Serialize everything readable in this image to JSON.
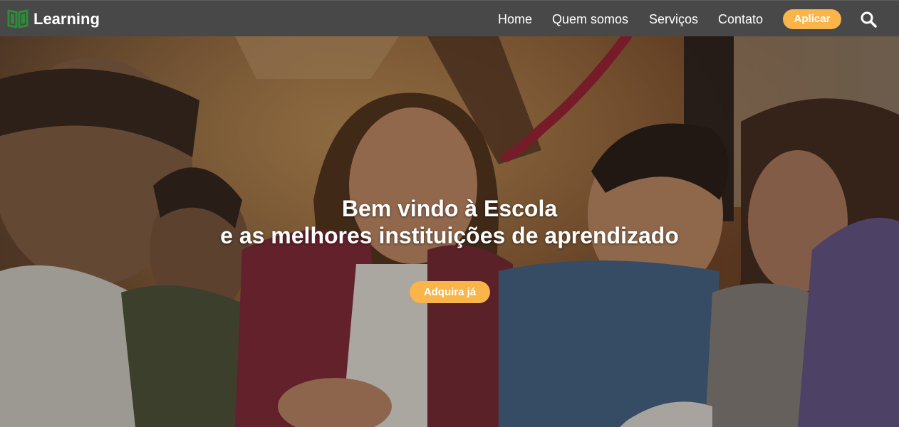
{
  "navbar": {
    "brand": "Learning",
    "logo_icon": "book-icon",
    "links": [
      {
        "label": "Home"
      },
      {
        "label": "Quem somos"
      },
      {
        "label": "Serviços"
      },
      {
        "label": "Contato"
      }
    ],
    "apply_label": "Aplicar",
    "search_icon": "search-icon"
  },
  "hero": {
    "heading_line1": "Bem vindo à Escola",
    "heading_line2": "e as melhores instituições de aprendizado",
    "cta_label": "Adquira já"
  },
  "colors": {
    "navbar_bg": "#484848",
    "accent": "#f9b44a",
    "logo_green": "#2e8b3a",
    "text": "#ffffff"
  }
}
